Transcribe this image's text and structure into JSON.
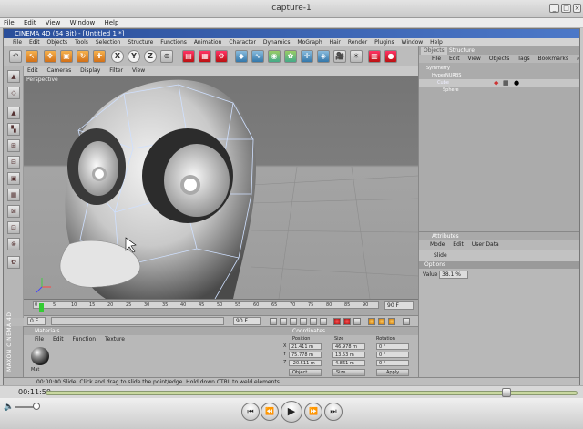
{
  "player": {
    "title": "capture-1",
    "menu": [
      "File",
      "Edit",
      "View",
      "Window",
      "Help"
    ],
    "time": "00:11:50",
    "buttons": {
      "prev": "⏮",
      "rewind": "⏪",
      "play": "▶",
      "forward": "⏩",
      "next": "⏭"
    }
  },
  "c4d": {
    "title": "CINEMA 4D (64 Bit) - [Untitled 1 *]",
    "menu": [
      "File",
      "Edit",
      "Objects",
      "Tools",
      "Selection",
      "Structure",
      "Functions",
      "Animation",
      "Character",
      "Dynamics",
      "MoGraph",
      "Hair",
      "Render",
      "Plugins",
      "Window",
      "Help"
    ],
    "toolbar_axes": [
      "X",
      "Y",
      "Z"
    ],
    "viewport": {
      "menu": [
        "Edit",
        "Cameras",
        "Display",
        "Filter",
        "View"
      ],
      "label": "Perspective"
    },
    "timeline": {
      "ticks": [
        "0",
        "5",
        "10",
        "15",
        "20",
        "25",
        "30",
        "35",
        "40",
        "45",
        "50",
        "55",
        "60",
        "65",
        "70",
        "75",
        "80",
        "85",
        "90"
      ],
      "frame_left": "0 F",
      "frame_right": "90 F",
      "start": "0 F",
      "end": "90 F"
    },
    "materials": {
      "header": "Materials",
      "menu": [
        "File",
        "Edit",
        "Function",
        "Texture"
      ],
      "item": "Mat"
    },
    "coordinates": {
      "header": "Coordinates",
      "columns": [
        "Position",
        "Size",
        "Rotation"
      ],
      "rows": [
        {
          "axis": "X",
          "pos": "21.411 m",
          "size": "46.978 m",
          "rot": "0 °"
        },
        {
          "axis": "Y",
          "pos": "75.778 m",
          "size": "13.53 m",
          "rot": "0 °"
        },
        {
          "axis": "Z",
          "pos": "-20.511 m",
          "size": "4.861 m",
          "rot": "0 °"
        }
      ],
      "mode": "Object",
      "size_mode": "Size",
      "apply": "Apply"
    },
    "objects": {
      "tabs": [
        "Objects",
        "Structure"
      ],
      "menu": [
        "File",
        "Edit",
        "View",
        "Objects",
        "Tags",
        "Bookmarks"
      ],
      "rows": [
        "Symmetry",
        "HyperNURBS",
        "Cube",
        "Sphere"
      ]
    },
    "attributes": {
      "header": "Attributes",
      "menu": [
        "Mode",
        "Edit",
        "User Data"
      ],
      "tool": "Slide",
      "section": "Options",
      "value_label": "Value",
      "value": "38.1 %"
    },
    "status": "00:00:00    Slide: Click and drag to slide the point/edge. Hold down CTRL to weld elements.",
    "brand": "MAXON CINEMA 4D"
  }
}
